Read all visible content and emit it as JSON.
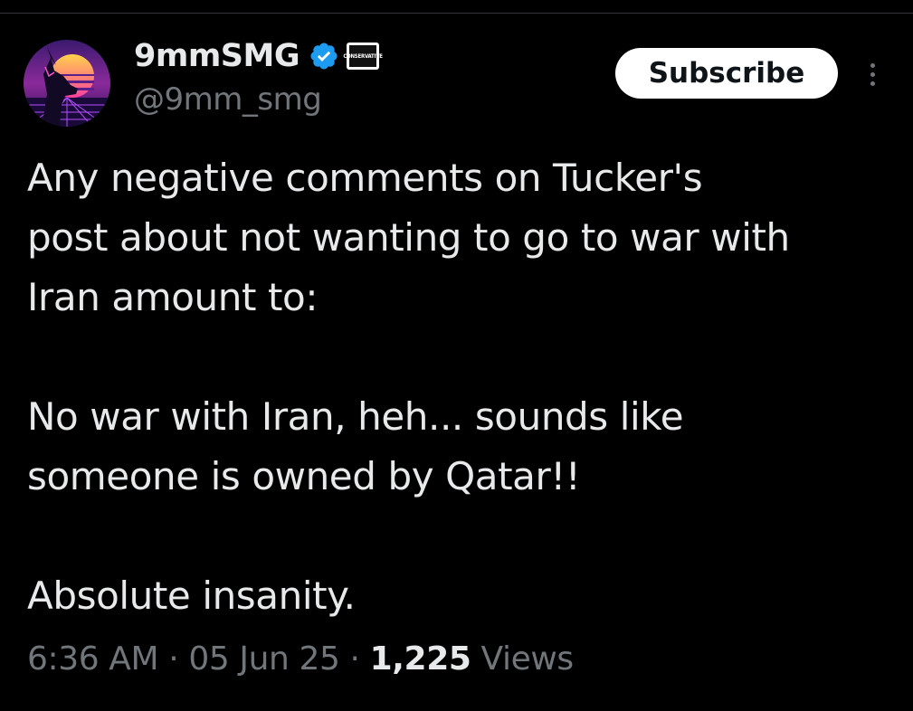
{
  "tweet": {
    "author": {
      "display_name": "9mmSMG",
      "handle": "@9mm_smg",
      "verified": true,
      "affiliation_badge_text": "CONSERVATIVE",
      "avatar_icon": "avatar-synthwave-dog"
    },
    "subscribe_label": "Subscribe",
    "more_icon": "more-vertical-icon",
    "text": {
      "paragraph_1_line_1": "Any negative comments on Tucker's",
      "paragraph_1_line_2": "post about not wanting to go to war with",
      "paragraph_1_line_3": "Iran amount to:",
      "paragraph_2_line_1": "No war with Iran, heh... sounds like",
      "paragraph_2_line_2": "someone is owned by Qatar!!",
      "paragraph_3_line_1": "Absolute insanity."
    },
    "meta": {
      "time": "6:36 AM",
      "separator": " · ",
      "date": "05 Jun 25",
      "views_count": "1,225",
      "views_label": "Views"
    }
  },
  "colors": {
    "background": "#000000",
    "text_primary": "#e7e9ea",
    "text_secondary": "#71767b",
    "verified_blue": "#1d9bf0",
    "button_bg": "#ffffff"
  }
}
